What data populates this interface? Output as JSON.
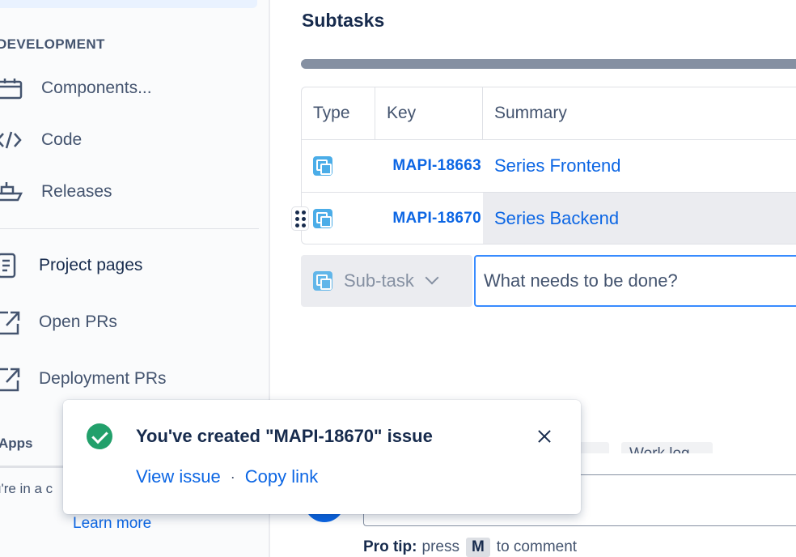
{
  "sidebar": {
    "section_heading": "DEVELOPMENT",
    "items": [
      {
        "label": "Components...",
        "icon": "components-icon"
      },
      {
        "label": "Code",
        "icon": "code-icon"
      },
      {
        "label": "Releases",
        "icon": "ship-icon"
      },
      {
        "label": "Project pages",
        "icon": "page-icon"
      },
      {
        "label": "Open PRs",
        "icon": "external-link-icon"
      },
      {
        "label": "Deployment PRs",
        "icon": "external-link-icon"
      }
    ],
    "apps_heading": "Apps",
    "apps_note": "u're in a c",
    "learn_more": "Learn more"
  },
  "main": {
    "subtasks_title": "Subtasks",
    "columns": {
      "type": "Type",
      "key": "Key",
      "summary": "Summary"
    },
    "rows": [
      {
        "key": "MAPI-18663",
        "summary": "Series Frontend"
      },
      {
        "key": "MAPI-18670",
        "summary": "Series Backend"
      }
    ],
    "new_subtask": {
      "type_label": "Sub-task",
      "placeholder": "What needs to be done?"
    },
    "tabs": [
      "ory",
      "Work log"
    ],
    "pro_tip": {
      "label": "Pro tip:",
      "before": "press",
      "key": "M",
      "after": "to comment"
    }
  },
  "toast": {
    "title": "You've created \"MAPI-18670\" issue",
    "view_issue": "View issue",
    "separator": "·",
    "copy_link": "Copy link"
  },
  "colors": {
    "link": "#0c66e4",
    "success": "#22a06b",
    "subtask_icon": "#4bade8",
    "focus": "#388bff"
  }
}
